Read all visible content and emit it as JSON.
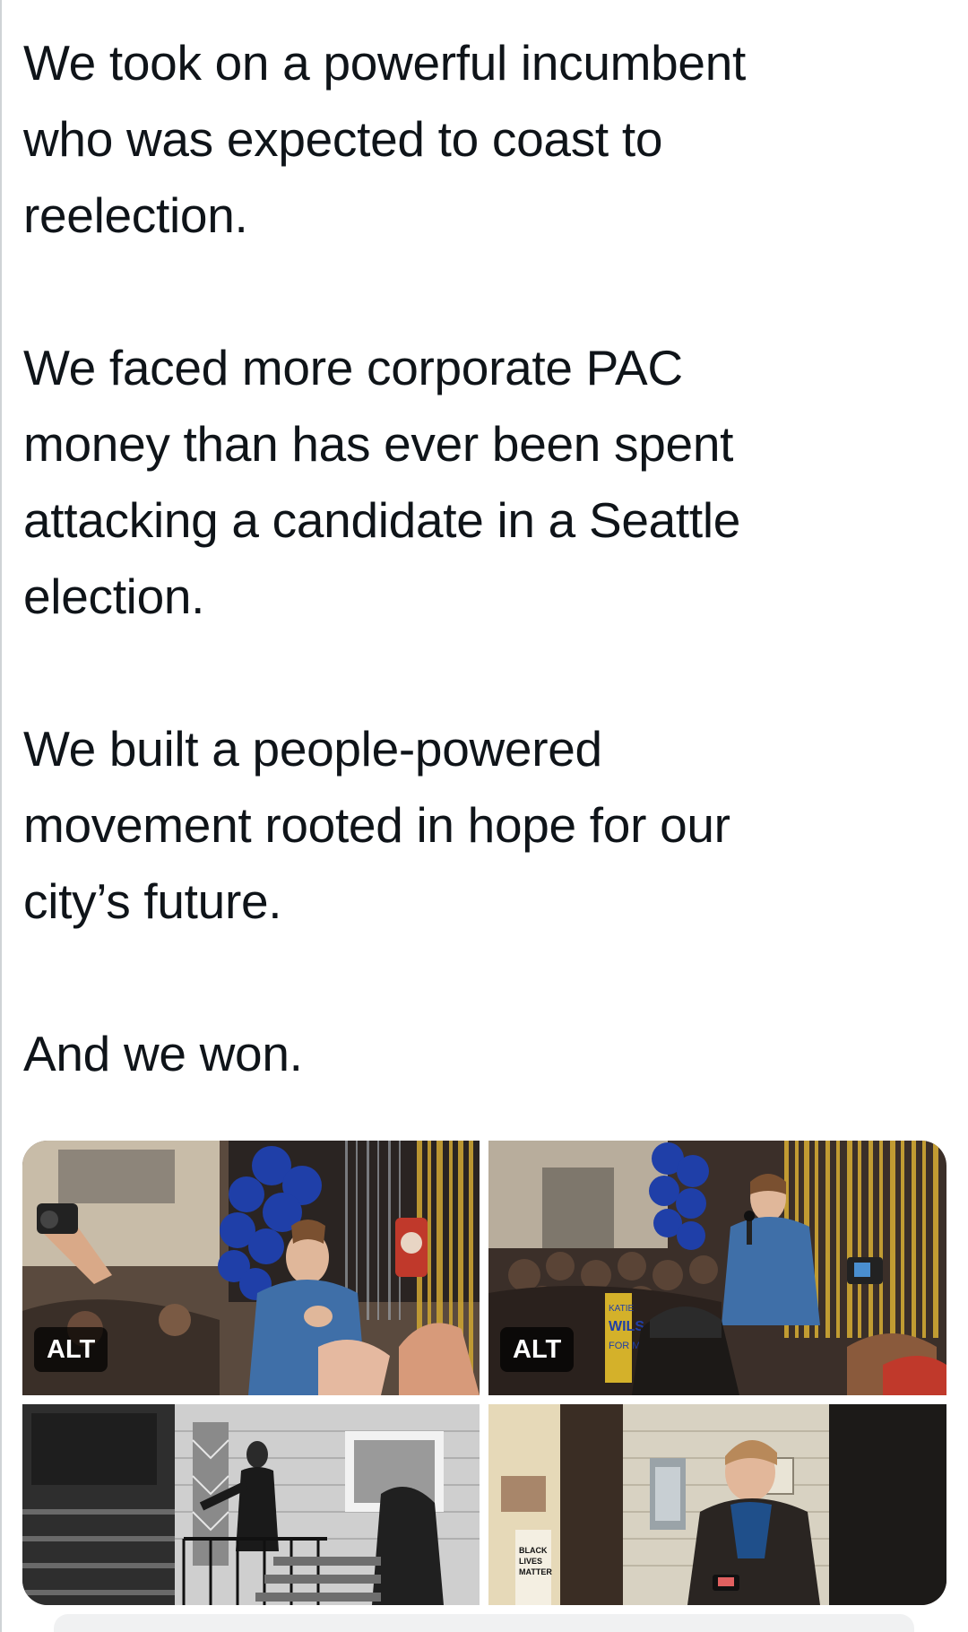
{
  "tweet": {
    "paragraphs": [
      {
        "lines": [
          "We took on a powerful incumbent",
          "who was expected to coast to",
          "reelection."
        ]
      },
      {
        "lines": [
          "We faced more corporate PAC",
          "money than has ever been spent",
          "attacking a candidate in a Seattle",
          "election."
        ]
      },
      {
        "lines": [
          "We built a people-powered",
          "movement rooted in hope for our",
          "city’s future."
        ]
      },
      {
        "lines": [
          "And we won."
        ]
      }
    ]
  },
  "media": {
    "alt_label": "ALT",
    "photos": [
      {
        "name": "crowd-celebration-photo",
        "has_alt": true
      },
      {
        "name": "victory-speech-photo",
        "has_alt": true
      },
      {
        "name": "porch-stairs-photo",
        "has_alt": false
      },
      {
        "name": "doorway-phone-photo",
        "has_alt": false
      }
    ],
    "sign_text": [
      "KATIE",
      "WILS",
      "FOR M"
    ],
    "poster_text": [
      "BLACK",
      "LIVES",
      "MATTER"
    ]
  },
  "colors": {
    "text": "#0f1419",
    "balloon_blue": "#1f3fa8",
    "tinsel_gold": "#c9a233",
    "jacket_blue": "#3f6fa8"
  }
}
